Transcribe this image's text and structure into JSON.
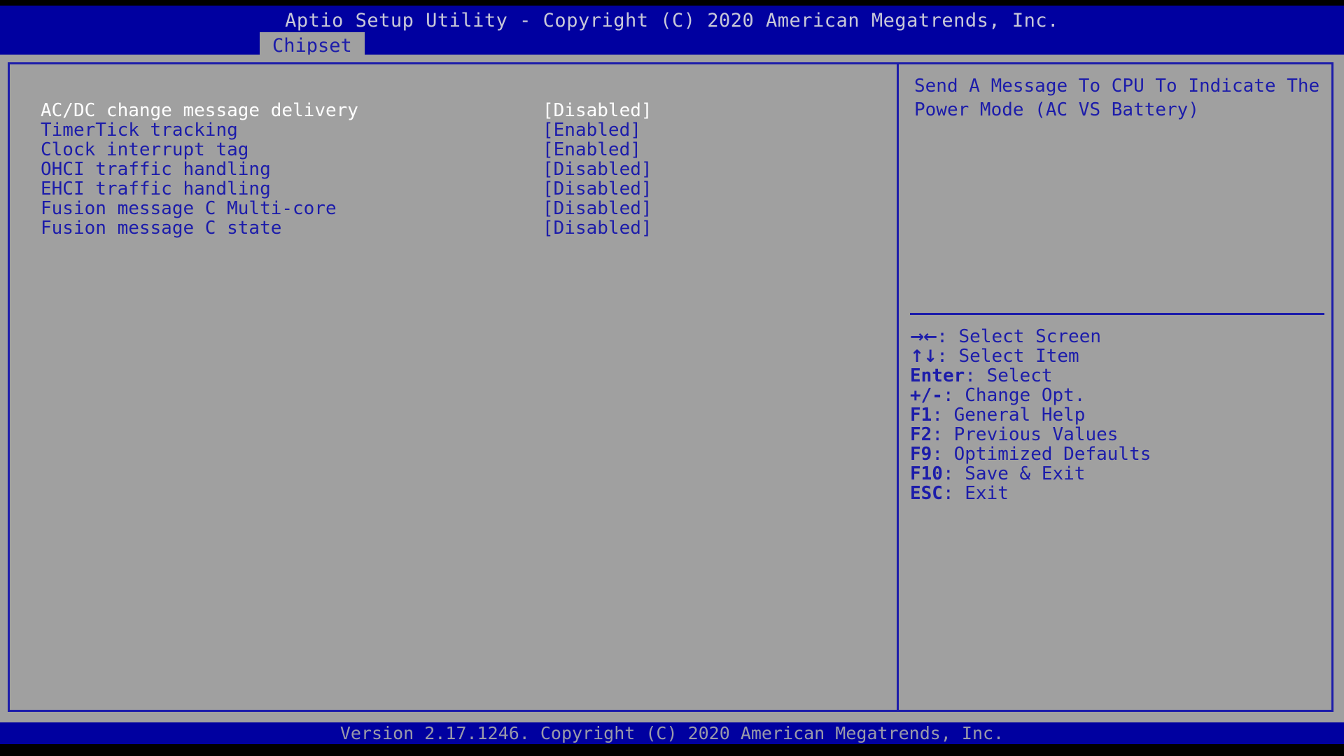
{
  "header": {
    "title": "Aptio Setup Utility - Copyright (C) 2020 American Megatrends, Inc.",
    "active_tab": "Chipset"
  },
  "colors": {
    "header_blue": "#0000a0",
    "body_gray": "#a0a0a0",
    "text_blue": "#1c1caa",
    "text_white": "#ffffff",
    "footer_text": "#9a9aaa"
  },
  "settings": [
    {
      "label": "AC/DC change message delivery",
      "value": "[Disabled]",
      "selected": true
    },
    {
      "label": "TimerTick tracking",
      "value": "[Enabled]",
      "selected": false
    },
    {
      "label": "Clock interrupt tag",
      "value": "[Enabled]",
      "selected": false
    },
    {
      "label": "OHCI traffic handling",
      "value": "[Disabled]",
      "selected": false
    },
    {
      "label": "EHCI traffic handling",
      "value": "[Disabled]",
      "selected": false
    },
    {
      "label": "Fusion message C Multi-core",
      "value": "[Disabled]",
      "selected": false
    },
    {
      "label": "Fusion message C state",
      "value": "[Disabled]",
      "selected": false
    }
  ],
  "help": {
    "text": "Send A Message To CPU To Indicate The Power Mode (AC VS Battery)"
  },
  "legend": [
    {
      "key": "→←",
      "arrow": true,
      "text": ": Select Screen"
    },
    {
      "key": "↑↓",
      "arrow": true,
      "text": ": Select Item"
    },
    {
      "key": "Enter",
      "arrow": false,
      "text": ": Select"
    },
    {
      "key": "+/-",
      "arrow": false,
      "text": ": Change Opt."
    },
    {
      "key": "F1",
      "arrow": false,
      "text": ": General Help"
    },
    {
      "key": "F2",
      "arrow": false,
      "text": ": Previous Values"
    },
    {
      "key": "F9",
      "arrow": false,
      "text": ": Optimized Defaults"
    },
    {
      "key": "F10",
      "arrow": false,
      "text": ": Save & Exit"
    },
    {
      "key": "ESC",
      "arrow": false,
      "text": ": Exit"
    }
  ],
  "footer": {
    "text": "Version 2.17.1246. Copyright (C) 2020 American Megatrends, Inc."
  }
}
